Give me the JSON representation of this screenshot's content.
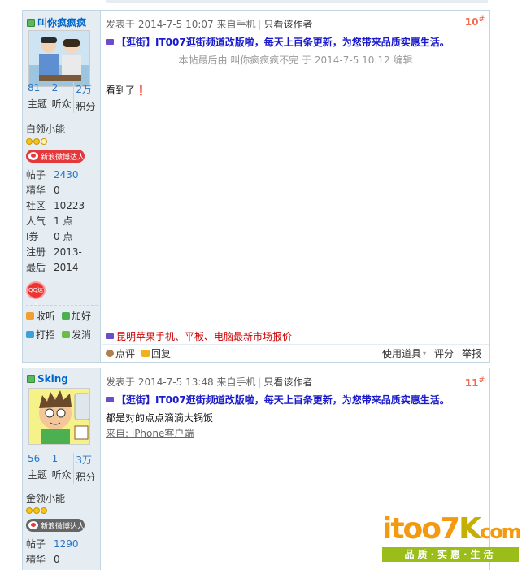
{
  "top": {
    "text": "使用道具 评分"
  },
  "posts": [
    {
      "username": "叫你疯疯疯",
      "stats": [
        {
          "n": "81",
          "l": "主题"
        },
        {
          "n": "2",
          "l": "听众"
        },
        {
          "n": "2万",
          "l": "积分"
        }
      ],
      "group": "白领小能",
      "weibo": "新浪微博达人",
      "info": [
        {
          "k": "帖子",
          "v": "2430"
        },
        {
          "k": "精华",
          "v": "0"
        },
        {
          "k": "社区",
          "v": "10223"
        },
        {
          "k": "人气",
          "v": "1 点"
        },
        {
          "k": "I券",
          "v": "0 点"
        },
        {
          "k": "注册",
          "v": "2013-"
        },
        {
          "k": "最后",
          "v": "2014-"
        }
      ],
      "medal": "QQ达人",
      "actions": [
        "收听",
        "加好",
        "打招",
        "发消"
      ],
      "posted": "发表于 2014-7-5 10:07 来自手机",
      "only_author": "只看该作者",
      "floor": "10",
      "ad": "【逛街】IT007逛街频道改版啦，每天上百条更新，为您带来品质实惠生活。",
      "edited": "本帖最后由 叫你疯疯疯不完 于 2014-7-5 10:12 编辑",
      "content": "看到了❗",
      "ad_bottom": "昆明苹果手机、平板、电脑最新市场报价",
      "foot_left": [
        "点评",
        "回复"
      ],
      "foot_right": [
        "使用道具",
        "评分",
        "举报"
      ]
    },
    {
      "username": "Sking",
      "stats": [
        {
          "n": "56",
          "l": "主题"
        },
        {
          "n": "1",
          "l": "听众"
        },
        {
          "n": "3万",
          "l": "积分"
        }
      ],
      "group": "金领小能",
      "weibo": "新浪微博达人",
      "info": [
        {
          "k": "帖子",
          "v": "1290"
        },
        {
          "k": "精华",
          "v": "0"
        }
      ],
      "posted": "发表于 2014-7-5 13:48 来自手机",
      "only_author": "只看该作者",
      "floor": "11",
      "ad": "【逛街】IT007逛街频道改版啦，每天上百条更新，为您带来品质实惠生活。",
      "content": "都是对的点点滴滴大锅饭",
      "source": "来自: iPhone客户端"
    }
  ],
  "logo": {
    "main": "itoo7",
    "tail": "com",
    "slogan": "品质·实惠·生活"
  },
  "colors": {
    "border": "#c2d5e3",
    "side": "#e5edf2",
    "link": "#2a76c6",
    "floor": "#f26c4f",
    "logo_orange": "#f39a10",
    "logo_green": "#9bbd1a"
  }
}
